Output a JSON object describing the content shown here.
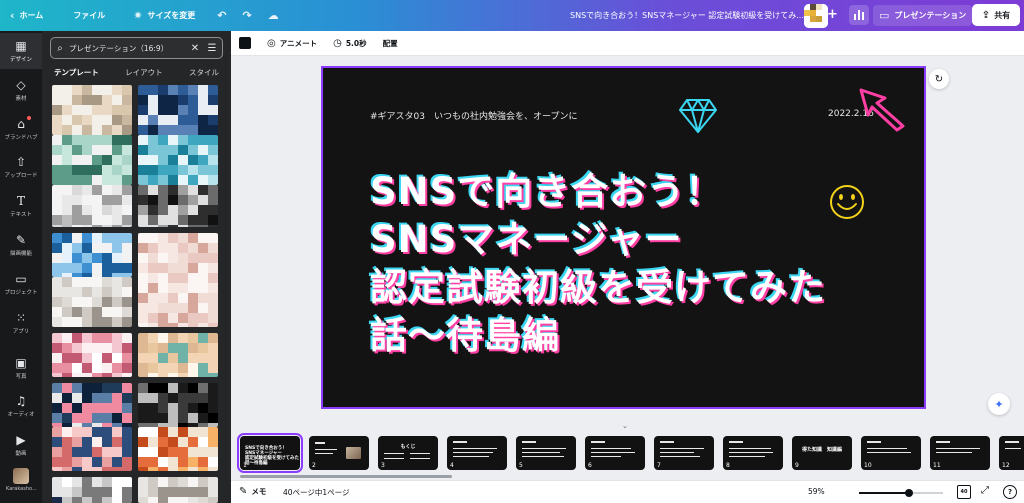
{
  "topbar": {
    "home_label": "ホーム",
    "file_label": "ファイル",
    "resize_label": "サイズを変更",
    "document_title": "SNSで向き合おう！SNSマネージャー 認定試験初級を受けてみ...",
    "present_label": "プレゼンテーション",
    "share_label": "共有",
    "plus_glyph": "+"
  },
  "rail": {
    "items": [
      {
        "label": "デザイン",
        "icon": "design-icon"
      },
      {
        "label": "素材",
        "icon": "elements-icon"
      },
      {
        "label": "ブランドハブ",
        "icon": "brand-icon"
      },
      {
        "label": "アップロード",
        "icon": "upload-icon"
      },
      {
        "label": "テキスト",
        "icon": "text-icon"
      },
      {
        "label": "描画機能",
        "icon": "draw-icon"
      },
      {
        "label": "プロジェクト",
        "icon": "folder-icon"
      },
      {
        "label": "アプリ",
        "icon": "apps-icon"
      },
      {
        "label": "写真",
        "icon": "photo-icon"
      },
      {
        "label": "オーディオ",
        "icon": "audio-icon"
      },
      {
        "label": "動画",
        "icon": "video-icon"
      }
    ],
    "user_label": "Karakasho..."
  },
  "panel": {
    "search_value": "プレゼンテーション（16:9）",
    "tabs": [
      "テンプレート",
      "レイアウト",
      "スタイル"
    ],
    "active_tab": 0
  },
  "ctxbar": {
    "color": "#0d1216",
    "animate_label": "アニメート",
    "duration_label": "5.0秒",
    "position_label": "配置"
  },
  "slide": {
    "tagline": "#ギアスタ03　いつもの社内勉強会を、オープンに",
    "date": "2022.2.16",
    "title_lines": [
      "SNSで向き合おう！",
      "SNSマネージャー",
      "認定試験初級を受けてみた",
      "話〜待島編"
    ],
    "accent_pink": "#ff3fa4",
    "accent_cyan": "#3ad6f2",
    "accent_yellow": "#f2d21b",
    "selection_color": "#8b3dff"
  },
  "filmstrip": {
    "pages": [
      "1",
      "2",
      "3",
      "4",
      "5",
      "6",
      "7",
      "8",
      "9",
      "10",
      "11",
      "12"
    ],
    "page1_text": [
      "SNSで向き合おう！",
      "SNSマネージャー",
      "認定試験初級を受けてみた",
      "話〜待島編"
    ],
    "page3_text": "もくじ",
    "page9_text": "得た知識　知識編"
  },
  "status": {
    "memo_label": "メモ",
    "page_label": "40ページ中1ページ",
    "zoom_label": "59%",
    "zoom_value": 59,
    "pages_badge": "40",
    "help_glyph": "?"
  }
}
